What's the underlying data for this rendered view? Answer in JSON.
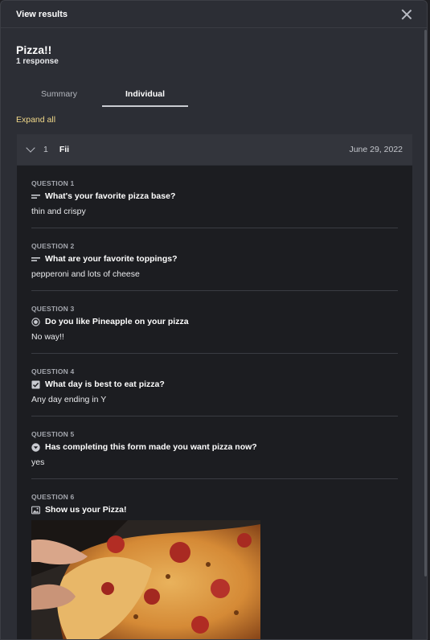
{
  "dialog": {
    "title": "View results"
  },
  "form": {
    "title": "Pizza!!",
    "response_count": "1 response"
  },
  "tabs": [
    {
      "label": "Summary",
      "active": false
    },
    {
      "label": "Individual",
      "active": true
    }
  ],
  "expand_all_label": "Expand all",
  "response": {
    "number": "1",
    "name": "Fii",
    "date": "June 29, 2022"
  },
  "questions": [
    {
      "label": "QUESTION 1",
      "icon": "text-answer-icon",
      "title": "What's your favorite pizza base?",
      "answer": "thin and crispy"
    },
    {
      "label": "QUESTION 2",
      "icon": "text-answer-icon",
      "title": "What are your favorite toppings?",
      "answer": "pepperoni and lots of cheese"
    },
    {
      "label": "QUESTION 3",
      "icon": "radio-icon",
      "title": "Do you like Pineapple on your pizza",
      "answer": "No way!!"
    },
    {
      "label": "QUESTION 4",
      "icon": "checkbox-icon",
      "title": "What day is best to eat pizza?",
      "answer": "Any day ending in Y"
    },
    {
      "label": "QUESTION 5",
      "icon": "dropdown-icon",
      "title": "Has completing this form made you want pizza now?",
      "answer": "yes"
    },
    {
      "label": "QUESTION 6",
      "icon": "image-icon",
      "title": "Show us your Pizza!",
      "answer": ""
    }
  ],
  "colors": {
    "accent": "#f2d98a",
    "panel": "#2c2e35",
    "answers_bg": "#1c1d21"
  }
}
